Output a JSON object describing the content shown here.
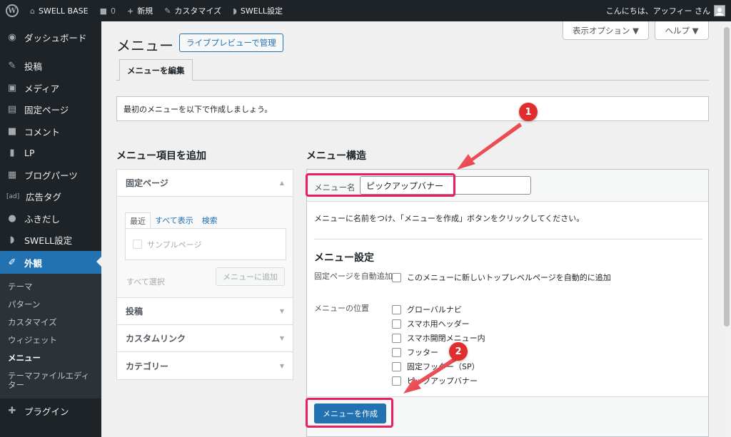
{
  "adminbar": {
    "site_name": "SWELL BASE",
    "comments_count": "0",
    "new_label": "新規",
    "customize_label": "カスタマイズ",
    "swell_settings_label": "SWELL設定",
    "greeting": "こんにちは、アッフィー さん"
  },
  "sidebar": {
    "items": [
      {
        "icon": "dashboard-icon",
        "glyph": "◉",
        "label": "ダッシュボード"
      },
      {
        "icon": "pin-icon",
        "glyph": "✎",
        "label": "投稿"
      },
      {
        "icon": "media-icon",
        "glyph": "▣",
        "label": "メディア"
      },
      {
        "icon": "page-icon",
        "glyph": "▤",
        "label": "固定ページ"
      },
      {
        "icon": "comment-icon",
        "glyph": "■",
        "label": "コメント"
      },
      {
        "icon": "document-icon",
        "glyph": "▮",
        "label": "LP"
      },
      {
        "icon": "blocks-icon",
        "glyph": "▦",
        "label": "ブログパーツ"
      },
      {
        "icon": "ad-icon",
        "glyph": "[ad]",
        "label": "広告タグ"
      },
      {
        "icon": "balloon-icon",
        "glyph": "●",
        "label": "ふきだし"
      },
      {
        "icon": "swell-icon",
        "glyph": "◗",
        "label": "SWELL設定"
      }
    ],
    "active": {
      "icon": "appearance-icon",
      "glyph": "✐",
      "label": "外観"
    },
    "submenu": [
      "テーマ",
      "パターン",
      "カスタマイズ",
      "ウィジェット",
      "メニュー",
      "テーマファイルエディター"
    ],
    "plugins": {
      "icon": "plugin-icon",
      "glyph": "✚",
      "label": "プラグイン"
    }
  },
  "top_buttons": {
    "screen_options": "表示オプション ▼",
    "help": "ヘルプ ▼"
  },
  "page": {
    "title": "メニュー",
    "live_preview": "ライブプレビューで管理",
    "tab_edit": "メニューを編集",
    "notice": "最初のメニューを以下で作成しましょう。"
  },
  "add_items": {
    "heading": "メニュー項目を追加",
    "pages": {
      "title": "固定ページ",
      "tabs": [
        "最近",
        "すべて表示",
        "検索"
      ],
      "sample_page": "サンプルページ",
      "select_all": "すべて選択",
      "add_button": "メニューに追加"
    },
    "sections": [
      "投稿",
      "カスタムリンク",
      "カテゴリー"
    ]
  },
  "structure": {
    "heading": "メニュー構造",
    "name_label": "メニュー名",
    "name_value": "ピックアップバナー",
    "instructions": "メニューに名前をつけ、「メニューを作成」ボタンをクリックしてください。",
    "settings_title": "メニュー設定",
    "auto_add_label": "固定ページを自動追加",
    "auto_add_text": "このメニューに新しいトップレベルページを自動的に追加",
    "location_label": "メニューの位置",
    "locations": [
      "グローバルナビ",
      "スマホ用ヘッダー",
      "スマホ開閉メニュー内",
      "フッター",
      "固定フッター（SP）",
      "ピックアップバナー"
    ],
    "create_button": "メニューを作成"
  },
  "annotations": [
    "1",
    "2"
  ],
  "colors": {
    "accent": "#2271b1",
    "highlight": "#e91e63",
    "badge": "#e02d2d"
  }
}
